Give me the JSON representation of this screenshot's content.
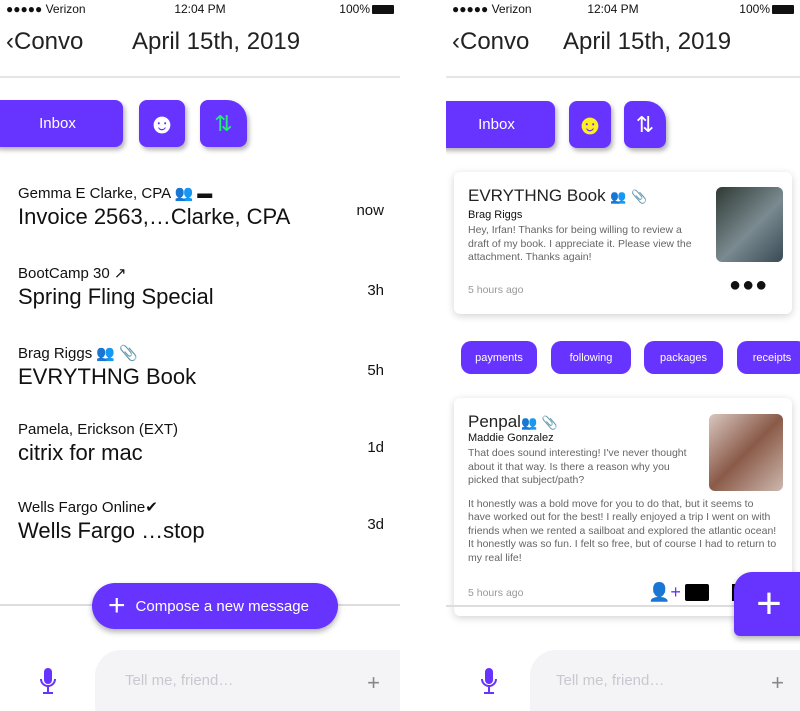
{
  "status": {
    "carrier": "●●●●● Verizon",
    "time": "12:04 PM",
    "battery": "100%"
  },
  "header": {
    "back": "Convo",
    "date": "April 15th, 2019"
  },
  "toolbar": {
    "inbox": "Inbox"
  },
  "colors": {
    "accent": "#6633ff",
    "sort_icon": "#22ee77",
    "emoji_right": "#ffee22"
  },
  "list": [
    {
      "from": "Gemma E Clarke, CPA",
      "subject": "Invoice 2563,…Clarke, CPA",
      "time": "now"
    },
    {
      "from": "BootCamp 30",
      "subject": "Spring Fling Special",
      "time": "3h"
    },
    {
      "from": "Brag Riggs",
      "subject": "EVRYTHNG Book",
      "time": "5h"
    },
    {
      "from": "Pamela, Erickson (EXT)",
      "subject": "citrix for mac",
      "time": "1d"
    },
    {
      "from": "Wells Fargo Online",
      "subject": "Wells Fargo …stop",
      "time": "3d"
    }
  ],
  "compose": "Compose a new message",
  "input": {
    "placeholder": "Tell me, friend…"
  },
  "cards": [
    {
      "title": "EVRYTHNG Book",
      "name": "Brag Riggs",
      "body": "Hey, Irfan! Thanks for being willing to review a draft of my book. I appreciate it. Please view the attachment. Thanks again!",
      "ago": "5 hours ago"
    },
    {
      "title": "Penpal",
      "name": "Maddie Gonzalez",
      "body": "That does sound interesting! I've never thought about it that way. Is there a reason why you picked that subject/path?",
      "reply": "It honestly was a bold move for you to do that, but it seems to have worked out for the best! I really enjoyed a trip I went on with friends when we rented a sailboat and explored the atlantic ocean! It honestly was so fun. I felt so free, but of course I had to return to my real life!",
      "ago": "5 hours ago"
    }
  ],
  "chips": [
    "payments",
    "following",
    "packages",
    "receipts"
  ]
}
